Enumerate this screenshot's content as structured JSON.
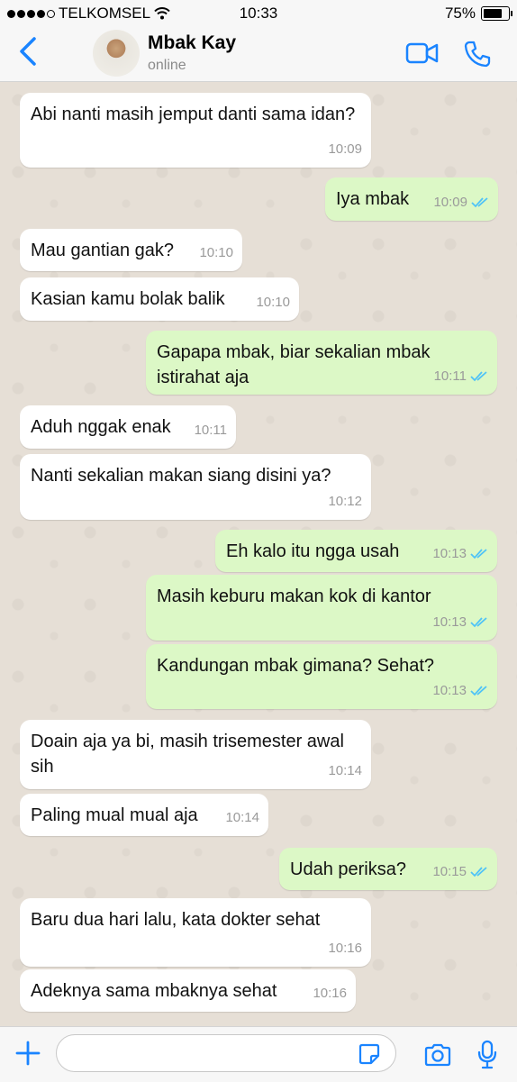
{
  "status_bar": {
    "carrier": "TELKOMSEL",
    "time": "10:33",
    "battery": "75%"
  },
  "header": {
    "back_icon": "chevron-left-icon",
    "contact_name": "Mbak Kay",
    "contact_status": "online",
    "video_icon": "video-camera-icon",
    "phone_icon": "phone-icon"
  },
  "messages": [
    {
      "dir": "in",
      "text": "Abi nanti masih jemput danti sama idan?",
      "time": "10:09"
    },
    {
      "dir": "out",
      "text": "Iya mbak",
      "time": "10:09"
    },
    {
      "dir": "in",
      "text": "Mau gantian gak?",
      "time": "10:10"
    },
    {
      "dir": "in",
      "text": "Kasian kamu bolak balik",
      "time": "10:10"
    },
    {
      "dir": "out",
      "text": "Gapapa mbak, biar sekalian mbak istirahat aja",
      "time": "10:11"
    },
    {
      "dir": "in",
      "text": "Aduh nggak enak",
      "time": "10:11"
    },
    {
      "dir": "in",
      "text": "Nanti sekalian makan siang disini ya?",
      "time": "10:12"
    },
    {
      "dir": "out",
      "text": "Eh kalo itu ngga usah",
      "time": "10:13"
    },
    {
      "dir": "out",
      "text": "Masih keburu makan kok di kantor",
      "time": "10:13"
    },
    {
      "dir": "out",
      "text": "Kandungan mbak gimana? Sehat?",
      "time": "10:13"
    },
    {
      "dir": "in",
      "text": "Doain aja ya bi, masih trisemester awal sih",
      "time": "10:14"
    },
    {
      "dir": "in",
      "text": "Paling mual mual aja",
      "time": "10:14"
    },
    {
      "dir": "out",
      "text": "Udah periksa?",
      "time": "10:15"
    },
    {
      "dir": "in",
      "text": "Baru dua hari lalu, kata dokter sehat",
      "time": "10:16"
    },
    {
      "dir": "in",
      "text": "Adeknya sama mbaknya sehat",
      "time": "10:16"
    }
  ],
  "input_bar": {
    "message_value": "",
    "plus_icon": "plus-icon",
    "sticker_icon": "sticker-icon",
    "camera_icon": "camera-icon",
    "mic_icon": "microphone-icon"
  },
  "colors": {
    "accent": "#1a84ff",
    "incoming_bubble": "#ffffff",
    "outgoing_bubble": "#dcf8c6",
    "read_ticks": "#4fc3f7",
    "chat_background": "#e6dfd6"
  }
}
